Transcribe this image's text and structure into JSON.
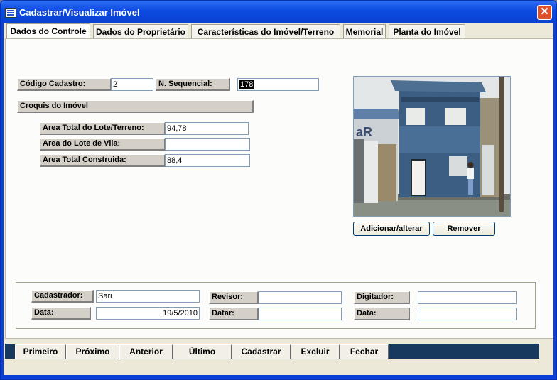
{
  "window": {
    "title": "Cadastrar/Visualizar Imóvel",
    "close_label": "✕"
  },
  "tabs": [
    {
      "label": "Dados do Controle"
    },
    {
      "label": "Dados do Proprietário"
    },
    {
      "label": "Características do Imóvel/Terreno"
    },
    {
      "label": "Memorial"
    },
    {
      "label": "Planta do Imóvel"
    }
  ],
  "form": {
    "codigo_label": "Código Cadastro:",
    "codigo_value": "2",
    "sequencial_label": "N. Sequencial:",
    "sequencial_value": "178",
    "croquis_label": "Croquis do Imóvel",
    "area_total_lote_label": "Area Total do Lote/Terreno:",
    "area_total_lote_value": "94,78",
    "area_lote_vila_label": "Area do Lote de Vila:",
    "area_lote_vila_value": "",
    "area_construida_label": "Area Total Construida:",
    "area_construida_value": "88,4"
  },
  "photo": {
    "add_button": "Adicionar/alterar",
    "remove_button": "Remover",
    "sign_text": "aR"
  },
  "audit": {
    "cadastrador_label": "Cadastrador:",
    "cadastrador_value": "Sari",
    "data1_label": "Data:",
    "data1_value": "19/5/2010",
    "revisor_label": "Revisor:",
    "revisor_value": "",
    "datar_label": "Datar:",
    "datar_value": "",
    "digitador_label": "Digitador:",
    "digitador_value": "",
    "data3_label": "Data:",
    "data3_value": ""
  },
  "nav": {
    "primeiro": "Primeiro",
    "proximo": "Próximo",
    "anterior": "Anterior",
    "ultimo": "Último",
    "cadastrar": "Cadastrar",
    "excluir": "Excluir",
    "fechar": "Fechar"
  }
}
